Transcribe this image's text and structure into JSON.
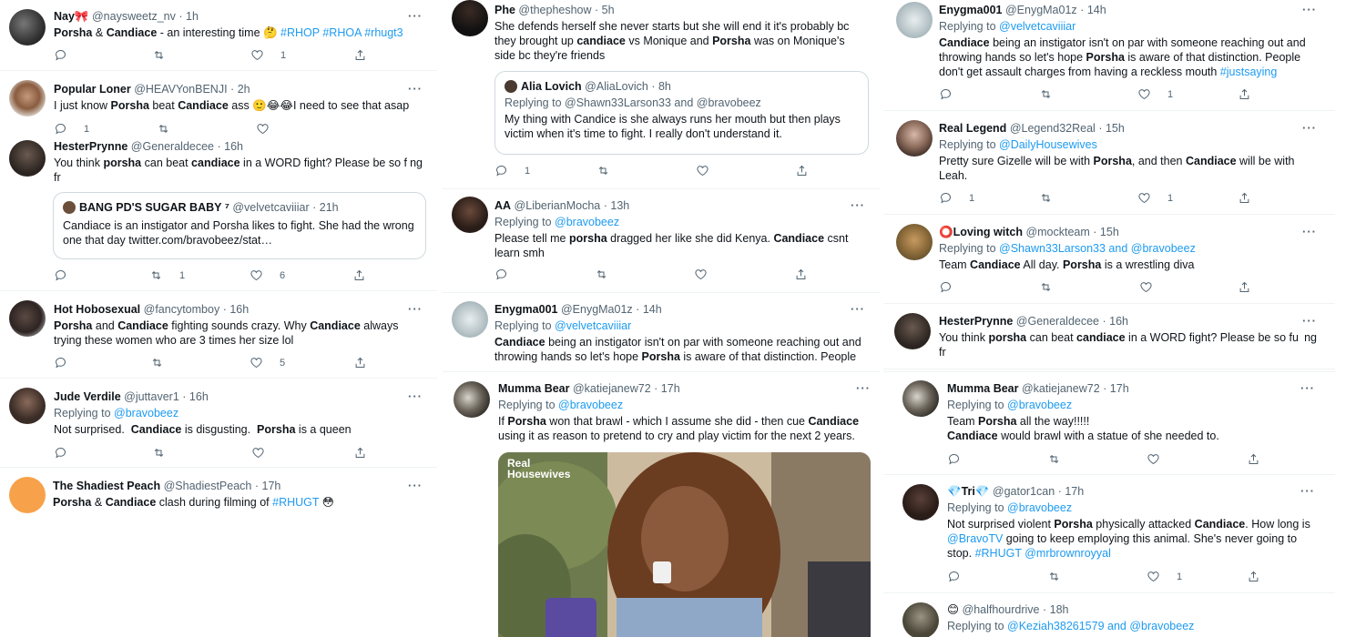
{
  "col1": {
    "t1": {
      "name": "Nay🎀",
      "handle": "@naysweetz_nv",
      "time": "1h",
      "text_a": "Porsha",
      "text_b": " & ",
      "text_c": "Candiace",
      "text_d": " - an interesting time 🤔 ",
      "tags": "#RHOP #RHOA #rhugt3",
      "likes": "1"
    },
    "t2": {
      "name": "Popular Loner",
      "handle": "@HEAVYonBENJI",
      "time": "2h",
      "text_a": "I just know ",
      "text_b": "Porsha",
      "text_c": " beat ",
      "text_d": "Candiace",
      "text_e": " ass 🙂😂😂I need to see that asap",
      "replies": "1"
    },
    "t3": {
      "name": "HesterPrynne",
      "handle": "@Generaldecee",
      "time": "16h",
      "text_a": "You think ",
      "text_b": "porsha",
      "text_c": " can beat ",
      "text_d": "candiace",
      "text_e": " in a WORD fight? Please be so f",
      "text_f": "ng",
      "text_g": "fr",
      "quote_name": "BANG PD'S SUGAR BABY ⁷",
      "quote_handle": "@velvetcaviiiar",
      "quote_time": "21h",
      "quote_text": "Candiace is an instigator and Porsha likes to fight. She had the wrong one that day twitter.com/bravobeez/stat…",
      "retweets": "1",
      "likes": "6"
    },
    "t4": {
      "name": "Hot Hobosexual",
      "handle": "@fancytomboy",
      "time": "16h",
      "text_a": "Porsha",
      "text_b": " and ",
      "text_c": "Candiace",
      "text_d": " fighting sounds crazy. Why ",
      "text_e": "Candiace",
      "text_f": " always trying these women who are 3 times her size lol",
      "likes": "5"
    },
    "t5": {
      "name": "Jude Verdile",
      "handle": "@juttaver1",
      "time": "16h",
      "replying": "Replying to ",
      "reply_link": "@bravobeez",
      "text_a": "Not surprised.  ",
      "text_b": "Candiace",
      "text_c": " is disgusting.  ",
      "text_d": "Porsha",
      "text_e": " is a queen"
    },
    "t6": {
      "name": "The Shadiest Peach",
      "handle": "@ShadiestPeach",
      "time": "17h",
      "text_a": "Porsha",
      "text_b": " & ",
      "text_c": "Candiace",
      "text_d": " clash during filming of ",
      "tag": "#RHUGT",
      "emoji": " 😳"
    }
  },
  "col2": {
    "t1": {
      "name": "Phe",
      "handle": "@thepheshow",
      "time": "5h",
      "text_a": "She defends herself she never starts but she will end it it's probably bc they brought up ",
      "text_b": "candiace",
      "text_c": " vs Monique and ",
      "text_d": "Porsha",
      "text_e": " was on Monique's side bc they're friends",
      "quote_name": "Alia Lovich",
      "quote_handle": "@AliaLovich",
      "quote_time": "8h",
      "quote_replying": "Replying to @Shawn33Larson33 and @bravobeez",
      "quote_text": "My thing with Candice is she always runs her mouth but then plays victim when it's time to fight. I really don't understand it.",
      "replies": "1"
    },
    "t2": {
      "name": "AA",
      "handle": "@LiberianMocha",
      "time": "13h",
      "replying": "Replying to ",
      "reply_link": "@bravobeez",
      "text_a": "Please tell me ",
      "text_b": "porsha",
      "text_c": " dragged her like she did Kenya. ",
      "text_d": "Candiace",
      "text_e": " csnt learn smh"
    },
    "t3": {
      "name": "Enygma001",
      "handle": "@EnygMa01z",
      "time": "14h",
      "replying": "Replying to ",
      "reply_link": "@velvetcaviiiar",
      "text_a": "Candiace",
      "text_b": " being an instigator isn't on par with someone reaching out and throwing hands so let's hope ",
      "text_c": "Porsha",
      "text_d": " is aware of that distinction. People"
    },
    "t4": {
      "name": "Mumma Bear",
      "handle": "@katiejanew72",
      "time": "17h",
      "replying": "Replying to ",
      "reply_link": "@bravobeez",
      "text_a": "If ",
      "text_b": "Porsha",
      "text_c": " won that brawl - which I assume she did - then cue ",
      "text_d": "Candiace",
      "text_e": " using it as reason to pretend to cry and play victim for the next 2 years.",
      "media_label_1": "Real",
      "media_label_2": "Housewives"
    }
  },
  "col3": {
    "t1": {
      "name": "Enygma001",
      "handle": "@EnygMa01z",
      "time": "14h",
      "replying": "Replying to ",
      "reply_link": "@velvetcaviiiar",
      "text_a": "Candiace",
      "text_b": " being an instigator isn't on par with someone reaching out and throwing hands so let's hope ",
      "text_c": "Porsha",
      "text_d": " is aware of that distinction. People don't get assault charges from having a reckless mouth ",
      "tag": "#justsaying",
      "likes": "1"
    },
    "t2": {
      "name": "Real Legend",
      "handle": "@Legend32Real",
      "time": "15h",
      "replying": "Replying to ",
      "reply_link": "@DailyHousewives",
      "text_a": "Pretty sure Gizelle will be with ",
      "text_b": "Porsha",
      "text_c": ", and then ",
      "text_d": "Candiace",
      "text_e": " will be with Leah.",
      "replies": "1",
      "likes": "1"
    },
    "t3": {
      "name": "⭕Loving witch",
      "handle": "@mockteam",
      "time": "15h",
      "replying": "Replying to ",
      "reply_link": "@Shawn33Larson33 and @bravobeez",
      "text_a": "Team ",
      "text_b": "Candiace",
      "text_c": " All day. ",
      "text_d": "Porsha",
      "text_e": " is a wrestling diva"
    },
    "t4": {
      "name": "HesterPrynne",
      "handle": "@Generaldecee",
      "time": "16h",
      "text_a": "You think ",
      "text_b": "porsha",
      "text_c": " can beat ",
      "text_d": "candiace",
      "text_e": " in a WORD fight? Please be so fu",
      "text_f": "ng",
      "text_g": "fr"
    },
    "t5": {
      "name": "Mumma Bear",
      "handle": "@katiejanew72",
      "time": "17h",
      "replying": "Replying to ",
      "reply_link": "@bravobeez",
      "text_a": "Team ",
      "text_b": "Porsha",
      "text_c": " all the way!!!!!",
      "text_d": "Candiace",
      "text_e": " would brawl with a statue of she needed to."
    },
    "t6": {
      "name": "💎Tri💎",
      "handle": "@gator1can",
      "time": "17h",
      "replying": "Replying to ",
      "reply_link": "@bravobeez",
      "text_a": "Not surprised violent ",
      "text_b": "Porsha",
      "text_c": " physically attacked ",
      "text_d": "Candiace",
      "text_e": ". How long is ",
      "link_a": "@BravoTV",
      "text_f": " going to keep employing this animal. She's never going to stop. ",
      "link_b": "#RHUGT @mrbrownroyyal",
      "likes": "1"
    },
    "t7": {
      "name": "😊",
      "handle": "@halfhourdrive",
      "time": "18h",
      "replying": "Replying to ",
      "reply_link": "@Keziah38261579 and @bravobeez"
    }
  },
  "common": {
    "dot": "·",
    "more": "···"
  },
  "colors": {
    "link": "#1d9bf0",
    "muted": "#536471",
    "text": "#0f1419",
    "border": "#eff3f4"
  },
  "icons": [
    "reply-icon",
    "retweet-icon",
    "like-icon",
    "share-icon",
    "more-icon"
  ]
}
